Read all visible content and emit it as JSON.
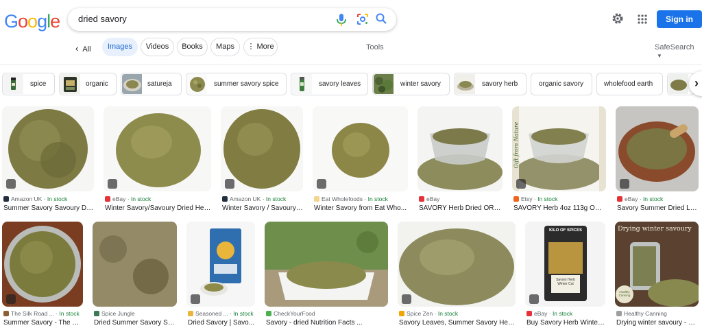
{
  "colors": {
    "accent": "#1a73e8",
    "in_stock": "#188038",
    "chip_active_bg": "#e8f0fe"
  },
  "logo": [
    "G",
    "o",
    "o",
    "g",
    "l",
    "e"
  ],
  "search": {
    "query": "dried savory"
  },
  "header": {
    "signin_label": "Sign in"
  },
  "tabs": {
    "back_label": "All",
    "items": [
      "Images",
      "Videos",
      "Books",
      "Maps",
      "More"
    ],
    "active": "Images",
    "tools_label": "Tools",
    "safesearch_label": "SafeSearch"
  },
  "chips": [
    "spice",
    "organic",
    "satureja",
    "summer savory spice",
    "savory leaves",
    "winter savory",
    "savory herb",
    "organic savory",
    "wholefood earth"
  ],
  "results": [
    {
      "source": "Amazon UK",
      "stock": "In stock",
      "title": "Summer Savory Savoury Dr..."
    },
    {
      "source": "eBay",
      "stock": "In stock",
      "title": "Winter Savory/Savoury Dried Her..."
    },
    {
      "source": "Amazon UK",
      "stock": "In stock",
      "title": "Winter Savory / Savoury ..."
    },
    {
      "source": "Eat Wholefoods",
      "stock": "In stock",
      "title": "Winter Savory from Eat Who..."
    },
    {
      "source": "eBay",
      "stock": "",
      "title": "SAVORY Herb Dried ORG..."
    },
    {
      "source": "Etsy",
      "stock": "In stock",
      "title": "SAVORY Herb 4oz 113g ORG..."
    },
    {
      "source": "eBay",
      "stock": "In stock",
      "title": "Savory Summer Dried Lo..."
    },
    {
      "source": "The Silk Road ...",
      "stock": "In stock",
      "title": "Summer Savory - The Si..."
    },
    {
      "source": "Spice Jungle",
      "stock": "",
      "title": "Dried Summer Savory Spi..."
    },
    {
      "source": "Seasoned ...",
      "stock": "In stock",
      "title": "Dried Savory | Savo..."
    },
    {
      "source": "CheckYourFood",
      "stock": "",
      "title": "Savory - dried Nutrition Facts ..."
    },
    {
      "source": "Spice Zen",
      "stock": "In stock",
      "title": "Savory Leaves, Summer Savory Her..."
    },
    {
      "source": "eBay",
      "stock": "In stock",
      "title": "Buy Savory Herb Winter..."
    },
    {
      "source": "Healthy Canning",
      "stock": "",
      "title": "Drying winter savoury - H..."
    }
  ],
  "overlay_texts": {
    "packet_brand": "KILO OF SPICES",
    "packet_name": "Savory Herb Winter Cut",
    "banner": "Drying winter savoury",
    "side_text": "Gift from Nature",
    "jar_label": "Healthy Canning"
  }
}
